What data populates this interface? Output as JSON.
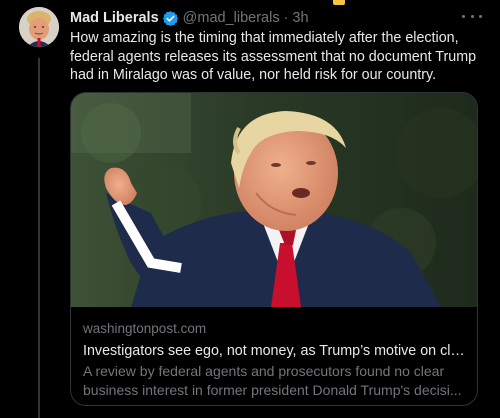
{
  "tweet": {
    "author_name": "Mad Liberals",
    "handle": "@mad_liberals",
    "separator": "·",
    "time": "3h",
    "text_lines": [
      "How amazing is the timing that immediately after the election,",
      "federal agents releases its assessment that no document Trump",
      "had in Miralago was of value, nor held risk for our country."
    ]
  },
  "card": {
    "domain": "washingtonpost.com",
    "title": "Investigators see ego, not money, as Trump’s motive on clas...",
    "description_lines": [
      "A review by federal agents and prosecutors found no clear",
      "business interest in former president Donald Trump's decisi..."
    ]
  },
  "icons": {
    "verified": "verified-badge-icon",
    "more": "more-options-icon"
  },
  "colors": {
    "background": "#000000",
    "text_primary": "#e7e9ea",
    "text_secondary": "#71767b",
    "verified_blue": "#1d9bf0",
    "border": "#2f3336"
  }
}
